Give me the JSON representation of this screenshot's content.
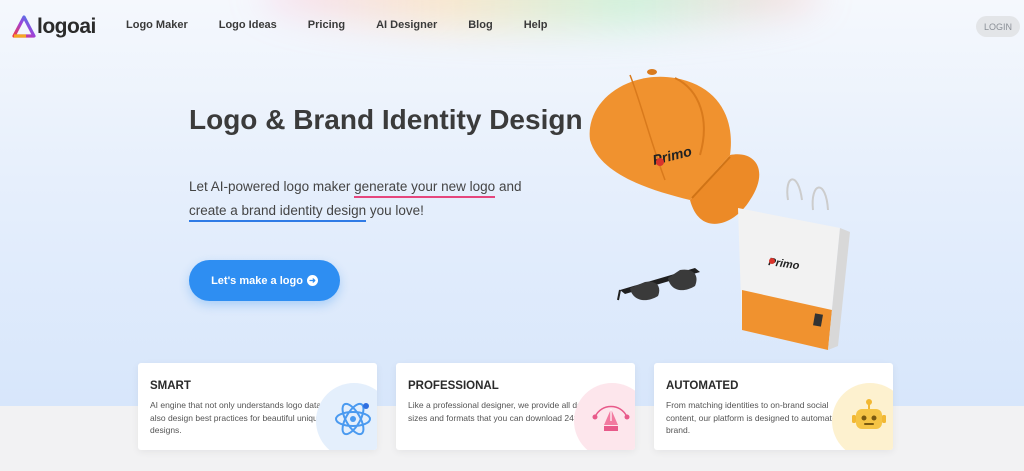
{
  "brand": {
    "name": "logoai"
  },
  "nav": {
    "links": [
      "Logo Maker",
      "Logo Ideas",
      "Pricing",
      "AI Designer",
      "Blog",
      "Help"
    ],
    "login": "LOGIN"
  },
  "hero": {
    "title": "Logo & Brand Identity Design",
    "sub_1": "Let AI-powered logo maker ",
    "sub_hl_1": "generate your new logo",
    "sub_2": " and",
    "sub_hl_2": "create a brand identity design",
    "sub_3": " you love!",
    "cta": "Let's make a logo",
    "cta_icon": "arrow-right-circle-icon",
    "mockup_text": "Primo"
  },
  "cards": [
    {
      "title": "SMART",
      "text": "AI engine that not only understands logo data but also design best practices for beautiful unique designs.",
      "icon": "atom-icon",
      "circle": "#e4effc"
    },
    {
      "title": "PROFESSIONAL",
      "text": "Like a professional designer, we provide all design sizes and formats that you can download 24x7.",
      "icon": "pen-tool-icon",
      "circle": "#fde6ec"
    },
    {
      "title": "AUTOMATED",
      "text": "From matching identities to on-brand social content, our platform is designed to automate your brand.",
      "icon": "robot-icon",
      "circle": "#fdf1cf"
    }
  ],
  "colors": {
    "accent": "#2e8ef2",
    "pink_underline": "#e5467d",
    "blue_underline": "#2f7be6",
    "cap": "#f0922f"
  }
}
